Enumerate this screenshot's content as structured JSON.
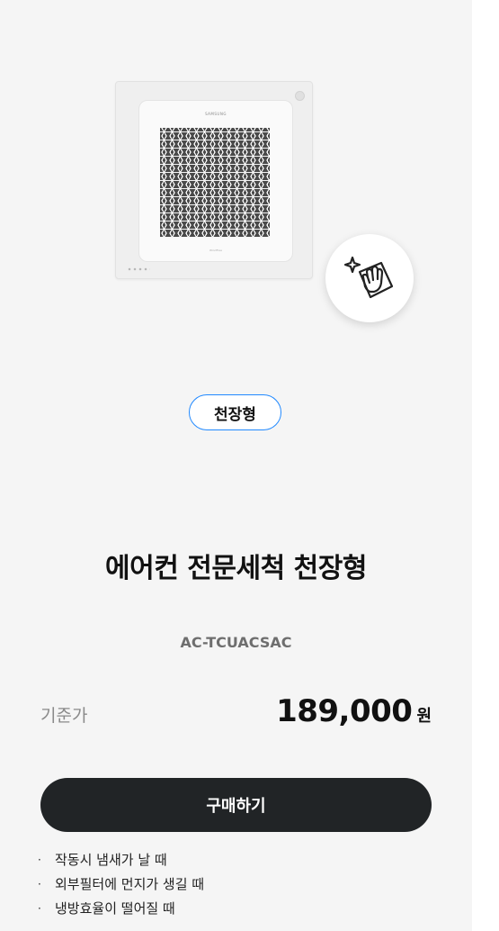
{
  "product": {
    "category_chip": "천장형",
    "title": "에어컨 전문세척 천장형",
    "model_code": "AC-TCUACSAC",
    "image_brand_text": "SAMSUNG",
    "image_sub_text": "WindFree"
  },
  "price": {
    "label": "기준가",
    "amount": "189,000",
    "currency": "원"
  },
  "buy_button": {
    "label": "구매하기"
  },
  "notes": [
    {
      "bullet": "·",
      "text": "작동시 냄새가 날 때"
    },
    {
      "bullet": "·",
      "text": "외부필터에 먼지가 생길 때"
    },
    {
      "bullet": "·",
      "text": "냉방효율이 떨어질 때"
    }
  ],
  "icons": {
    "badge": "cleaning-hand-icon"
  },
  "colors": {
    "background": "#f5f5f5",
    "chip_border": "#2189ff",
    "button_bg": "#212426",
    "button_text": "#ffffff",
    "label_gray": "#8a8a8a"
  }
}
